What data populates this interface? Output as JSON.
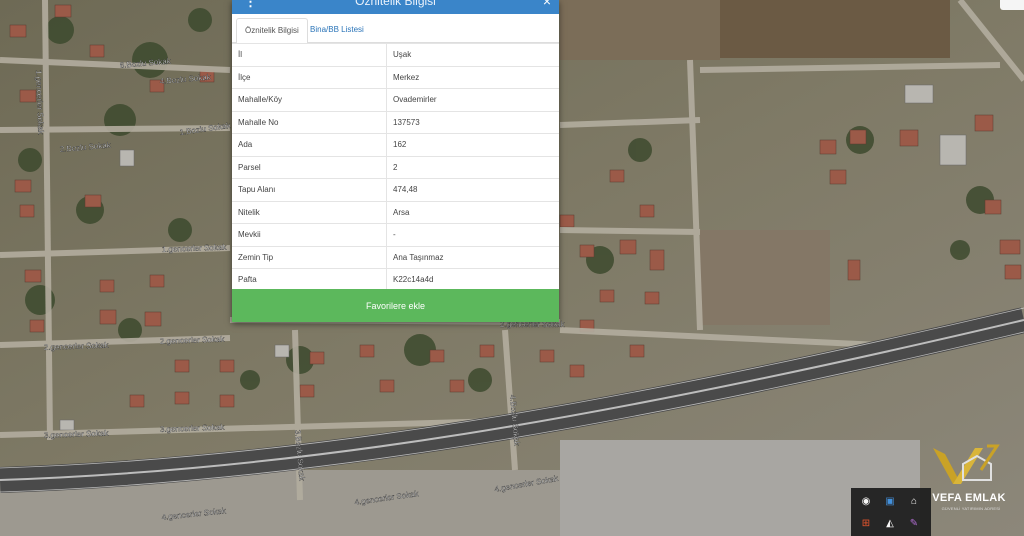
{
  "panel": {
    "title": "Öznitelik Bilgisi",
    "tabs": [
      {
        "label": "Öznitelik Bilgisi",
        "active": true
      },
      {
        "label": "Bina/BB Listesi",
        "active": false
      }
    ],
    "rows": [
      {
        "key": "İl",
        "value": "Uşak"
      },
      {
        "key": "İlçe",
        "value": "Merkez"
      },
      {
        "key": "Mahalle/Köy",
        "value": "Ovademirler"
      },
      {
        "key": "Mahalle No",
        "value": "137573"
      },
      {
        "key": "Ada",
        "value": "162"
      },
      {
        "key": "Parsel",
        "value": "2"
      },
      {
        "key": "Tapu Alanı",
        "value": "474,48"
      },
      {
        "key": "Nitelik",
        "value": "Arsa"
      },
      {
        "key": "Mevkii",
        "value": "-"
      },
      {
        "key": "Zemin Tip",
        "value": "Ana Taşınmaz"
      },
      {
        "key": "Pafta",
        "value": "K22c14a4d"
      }
    ],
    "favorite_button": "Favorilere ekle"
  },
  "map": {
    "streets": [
      "1.gencerler Sokak",
      "2.gencerler Sokak",
      "2.gencerler Sokak",
      "2.gencerler Sokak",
      "3.gencerler Sokak",
      "3.gencerler Sokak",
      "4.gencerler Sokak",
      "4.gencerler Sokak",
      "4.gencerler Sokak",
      "1.gencerler Sokak",
      "1.Bozlu Sokak",
      "2.Bozlu Sokak",
      "3.Bozlu Sokak",
      "4.Bozlu Sokak",
      "6.Bozlu Sokak",
      "4.Bozlu Sokak"
    ]
  },
  "logo": {
    "name": "VEFA EMLAK",
    "slogan": "GÜVENLİ YATIRIMIN ADRESİ"
  },
  "colors": {
    "panel_header": "#3a85c9",
    "favorite_button": "#5cb85c",
    "tab_link": "#2a74b8",
    "logo_gold": "#c9a227"
  }
}
